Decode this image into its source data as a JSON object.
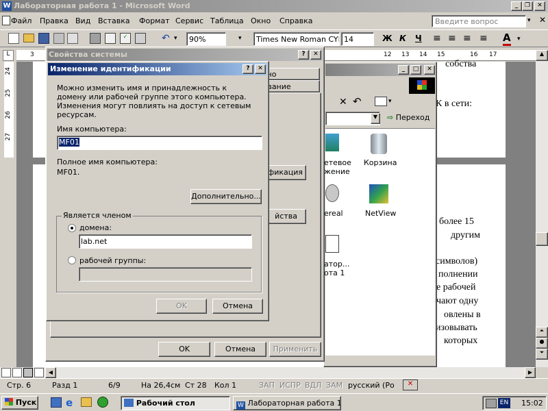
{
  "word": {
    "title": "Лабораторная работа 1 - Microsoft Word",
    "menu": [
      "Файл",
      "Правка",
      "Вид",
      "Вставка",
      "Формат",
      "Сервис",
      "Таблица",
      "Окно",
      "Справка"
    ],
    "help_placeholder": "Введите вопрос",
    "zoom": "90%",
    "font_name": "Times New Roman CYR",
    "font_size": "14",
    "bold": "Ж",
    "italic": "К",
    "underline": "Ч",
    "ruler_left_numbers": [
      "3"
    ],
    "ruler_right_numbers": [
      "12",
      "13",
      "14",
      "15",
      "16",
      "17"
    ],
    "vruler_numbers": [
      "24",
      "25",
      "26",
      "27"
    ],
    "doc_lines": [
      "собства",
      "К в сети:",
      "более   15",
      "другим",
      "символов)",
      "полнении",
      "е рабочей",
      "чают   одну",
      "овлены в",
      "изовывать",
      "которых"
    ]
  },
  "explorer": {
    "go_label": "Переход",
    "icons": [
      {
        "label1": "етевое",
        "label2": "жение"
      },
      {
        "label1": "Корзина",
        "label2": ""
      },
      {
        "label1": "ereal",
        "label2": ""
      },
      {
        "label1": "NetView",
        "label2": ""
      },
      {
        "label1": "атор...",
        "label2": "ота 1"
      }
    ]
  },
  "sysprops": {
    "title": "Свойства системы",
    "tab1": "льно",
    "tab2": "дование",
    "identify_btn": "ификация",
    "props_btn": "йства",
    "ok": "OK",
    "cancel": "Отмена",
    "apply": "Применить"
  },
  "dialog": {
    "title": "Изменение идентификации",
    "description": "Можно изменить имя и принадлежность к домену или рабочей группе этого компьютера. Изменения могут повлиять на доступ к сетевым ресурсам.",
    "computer_name_label": "Имя компьютера:",
    "computer_name_value": "MF01",
    "full_name_label": "Полное имя компьютера:",
    "full_name_value": "MF01.",
    "more_button": "Дополнительно...",
    "member_group": "Является членом",
    "domain_label": "домена:",
    "domain_value": "lab.net",
    "workgroup_label": "рабочей группы:",
    "workgroup_value": "",
    "ok": "OK",
    "cancel": "Отмена"
  },
  "statusbar": {
    "page": "Стр. 6",
    "section": "Разд 1",
    "pages": "6/9",
    "at": "На 26,4см",
    "line": "Ст 28",
    "col": "Кол 1",
    "rec": "ЗАП",
    "trk": "ИСПР",
    "ext": "ВДЛ",
    "ovr": "ЗАМ",
    "lang": "русский (Ро"
  },
  "taskbar": {
    "start": "Пуск",
    "task1": "Рабочий стол",
    "task2": "Лабораторная работа 1 ...",
    "lang": "EN",
    "time": "15:02"
  }
}
